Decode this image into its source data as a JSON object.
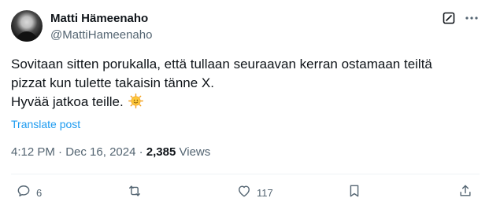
{
  "author": {
    "name": "Matti Hämeenaho",
    "handle": "@MattiHameenaho"
  },
  "tweet": {
    "lines": [
      "Sovitaan sitten porukalla, että tullaan seuraavan kerran ostamaan teiltä",
      "pizzat kun tulette takaisin tänne X.",
      "Hyvää jatkoa teille."
    ],
    "emoji": "smiling-sun"
  },
  "translate_label": "Translate post",
  "meta": {
    "time": "4:12 PM",
    "separator": "·",
    "date": "Dec 16, 2024",
    "views_count": "2,385",
    "views_label": "Views"
  },
  "actions": {
    "reply_count": "6",
    "like_count": "117"
  },
  "icons": {
    "grok": "grok-icon",
    "more": "more-dots-icon",
    "reply": "reply-icon",
    "repost": "repost-icon",
    "like": "heart-icon",
    "bookmark": "bookmark-icon",
    "share": "share-icon"
  },
  "colors": {
    "text": "#0f1419",
    "secondary": "#536471",
    "link": "#1d9bf0"
  }
}
